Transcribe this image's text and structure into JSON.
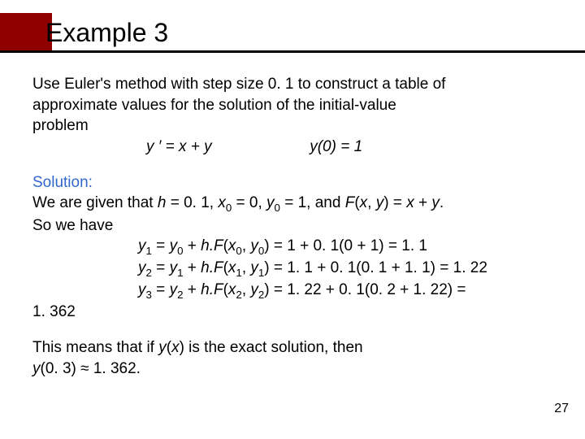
{
  "title": "Example 3",
  "problem_l1": "Use Euler's method with step size 0. 1 to construct a table of",
  "problem_l2": "approximate values for the solution of the initial-value",
  "problem_l3": "problem",
  "eq_left": "y ′ = x + y",
  "eq_right": "y(0) = 1",
  "solution_label": "Solution:",
  "given1_a": "We are given that ",
  "given1_b": "h",
  "given1_c": " = 0. 1, ",
  "given1_d": "x",
  "given1_e": " = 0, ",
  "given1_f": "y",
  "given1_g": " = 1, and ",
  "given1_h": "F",
  "given1_i": "(",
  "given1_j": "x",
  "given1_k": ", ",
  "given1_l": "y",
  "given1_m": ") = ",
  "given1_n": "x",
  "given1_o": " + ",
  "given1_p": "y",
  "given1_q": ".",
  "given2": "So we have",
  "calc1": "y₁ = y₀ + h.F(x₀, y₀) = 1 + 0. 1(0 + 1) = 1. 1",
  "calc2": "y₂ = y₁ + h.F(x₁, y₁) = 1. 1 + 0. 1(0. 1 + 1. 1) = 1. 22",
  "calc3": "y₃ = y₂ + h.F(x₂, y₂) = 1. 22 + 0. 1(0. 2 + 1. 22) =",
  "calc3_cont": "1. 362",
  "conc1_a": "This means that if ",
  "conc1_b": "y",
  "conc1_c": "(",
  "conc1_d": "x",
  "conc1_e": ") is the exact solution, then",
  "conc2_a": "y",
  "conc2_b": "(0. 3) ≈ 1. 362.",
  "pagenum": "27"
}
